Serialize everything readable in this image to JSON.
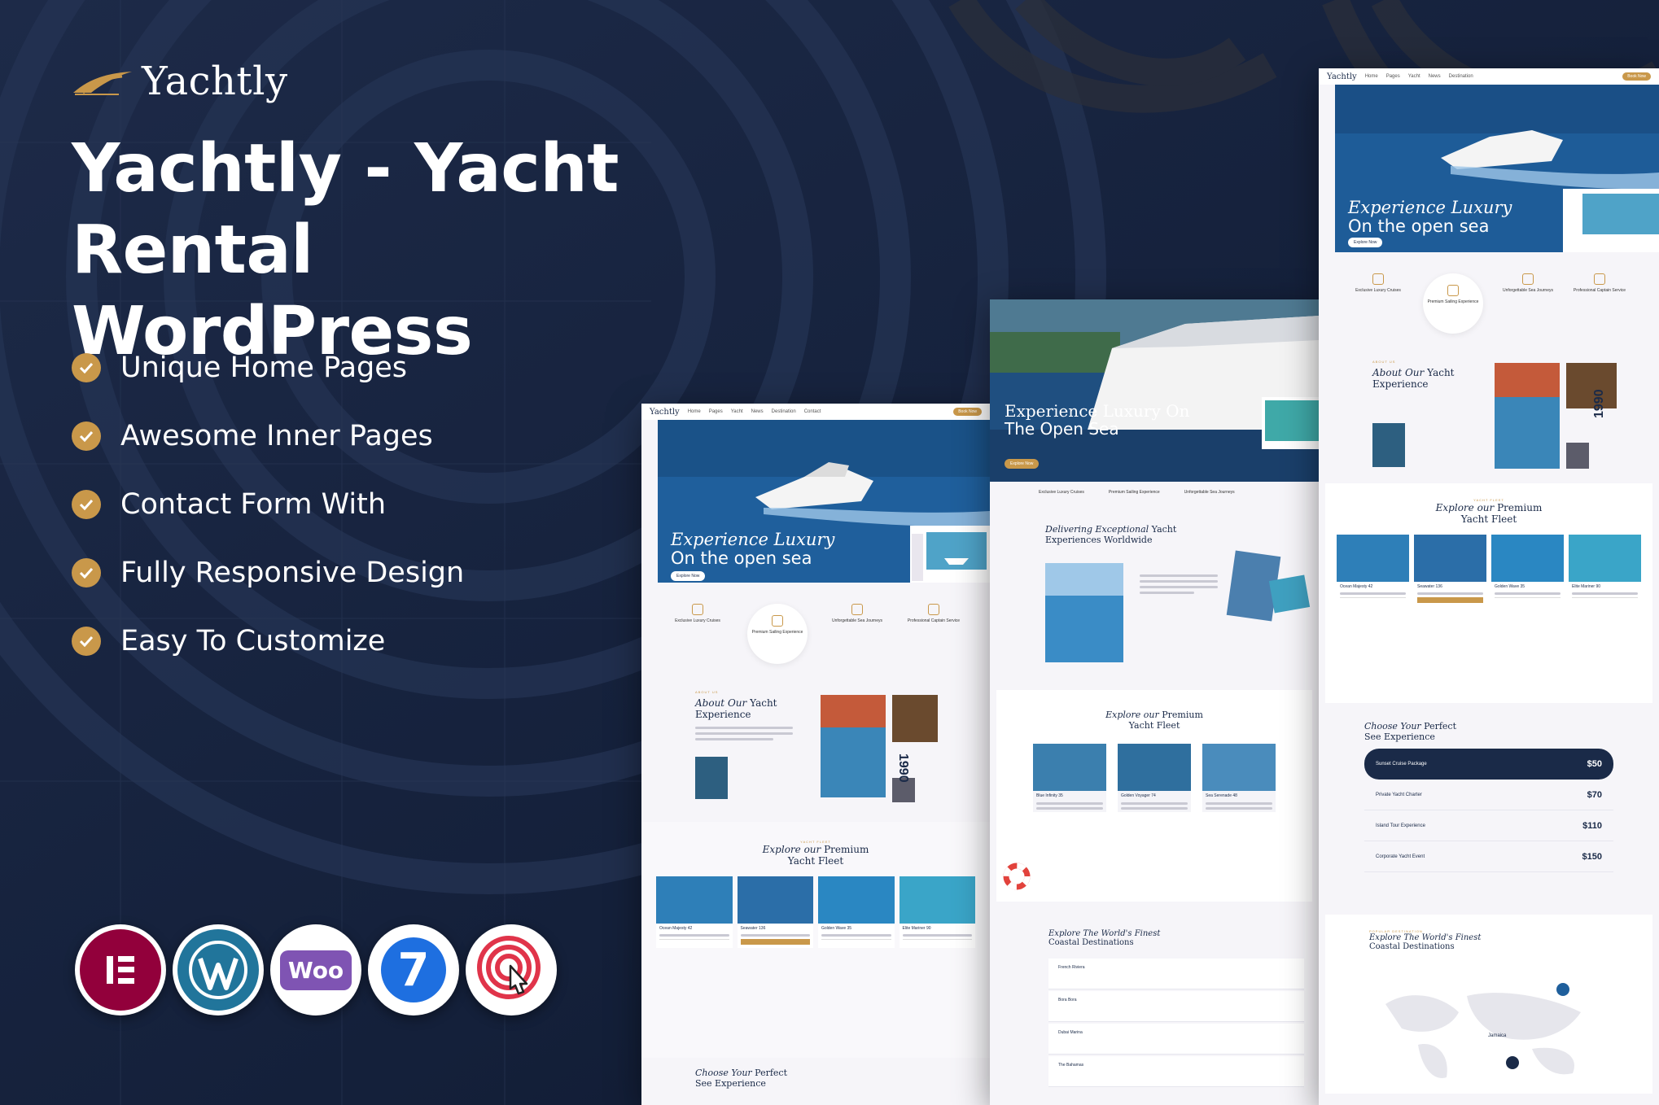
{
  "colors": {
    "background": "#121d36",
    "accent": "#c9984a",
    "navy": "#1a2a48",
    "sea": "#1f5f9c"
  },
  "brand": {
    "name": "Yachtly",
    "logo_icon": "sail-logo-icon"
  },
  "headline": {
    "line1": "Yachtly - Yacht Rental",
    "line2": "WordPress"
  },
  "features": [
    {
      "label": "Unique Home Pages",
      "icon": "check-circle-icon"
    },
    {
      "label": "Awesome Inner Pages",
      "icon": "check-circle-icon"
    },
    {
      "label": "Contact Form With",
      "icon": "check-circle-icon"
    },
    {
      "label": "Fully Responsive Design",
      "icon": "check-circle-icon"
    },
    {
      "label": "Easy To Customize",
      "icon": "check-circle-icon"
    }
  ],
  "plugins": [
    {
      "name": "elementor-icon"
    },
    {
      "name": "wordpress-icon"
    },
    {
      "name": "woocommerce-icon",
      "label": "Woo"
    },
    {
      "name": "contact-form-7-icon",
      "label": "7"
    },
    {
      "name": "touch-target-icon"
    }
  ],
  "mockups": {
    "nav_logo": "Yachtly",
    "nav_links": [
      "Home",
      "Pages",
      "Yacht",
      "News",
      "Destination",
      "Contact"
    ],
    "nav_cta": "Book Now",
    "hero_a": {
      "title": "Experience Luxury",
      "subtitle": "On the open sea",
      "button": "Explore Now"
    },
    "hero_b": {
      "title": "Experience Luxury On",
      "subtitle": "The Open Sea",
      "button": "Explore Now"
    },
    "services": [
      "Exclusive Luxury Cruises",
      "Premium Sailing Experience",
      "Unforgettable Sea Journeys",
      "Professional Captain Service"
    ],
    "about": {
      "label": "ABOUT US",
      "title_italic": "About Our",
      "title_rest": "Yacht",
      "title_line2": "Experience",
      "year": "1990"
    },
    "delivering": {
      "title_italic": "Delivering Exceptional",
      "title_rest": "Yacht",
      "title_line2": "Experiences Worldwide"
    },
    "fleet": {
      "label": "YACHT FLEET",
      "title_italic": "Explore our",
      "title_rest": "Premium",
      "title_line2": "Yacht Fleet",
      "watermark": "Explore",
      "yachts": [
        "Ocean Majesty 42",
        "Seawater 136",
        "Golden Wave 35",
        "Elite Mariner 90"
      ],
      "yachts_b": [
        "Blue Infinity 35",
        "Golden Voyager 74",
        "Sea Serenade 48"
      ]
    },
    "packages": {
      "title_italic": "Choose Your",
      "title_rest": "Perfect",
      "title_line2": "See Experience",
      "items": [
        {
          "name": "Sunset Cruise Package",
          "price": "$50"
        },
        {
          "name": "Private Yacht Charter",
          "price": "$70"
        },
        {
          "name": "Island Tour Experience",
          "price": "$110"
        },
        {
          "name": "Corporate Yacht Event",
          "price": "$150"
        }
      ]
    },
    "destinations": {
      "label": "POPULAR DESTINATION",
      "title_italic": "Explore The World's Finest",
      "title_line2": "Coastal Destinations",
      "items": [
        "French Riviera",
        "Bora Bora",
        "Dubai Marina",
        "The Bahamas"
      ],
      "map_label": "Jamaica"
    }
  }
}
